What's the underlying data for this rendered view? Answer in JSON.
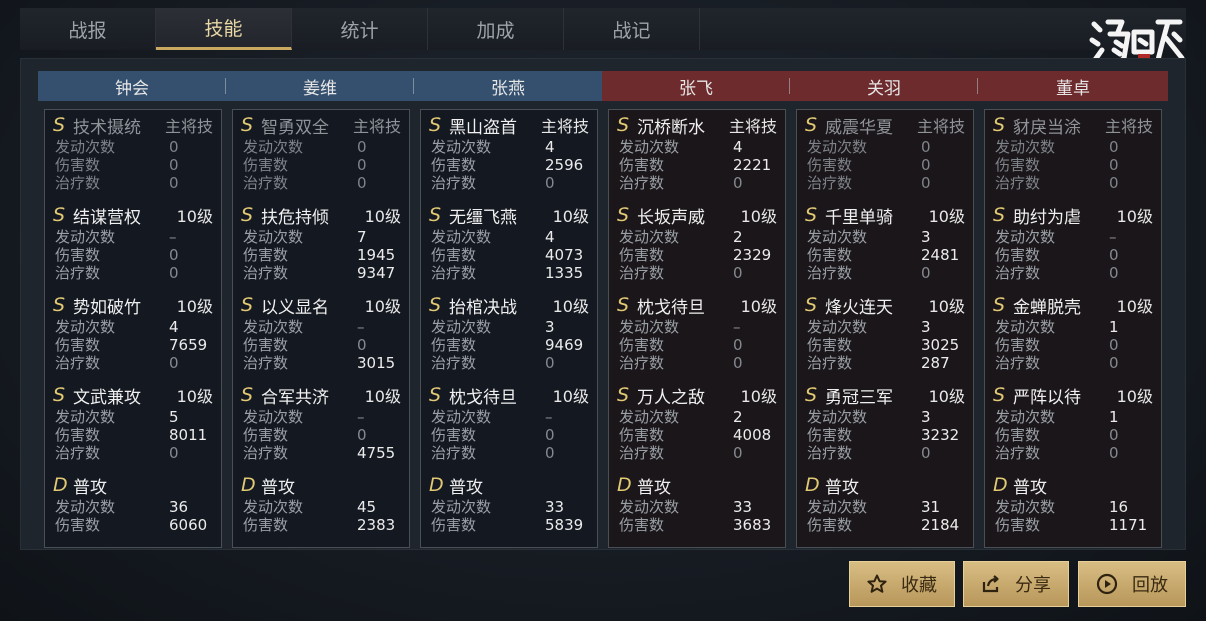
{
  "tabs": [
    "战报",
    "技能",
    "统计",
    "加成",
    "战记"
  ],
  "logo_text": "鸿图之下",
  "heroes": [
    {
      "name": "钟会",
      "side": "blue"
    },
    {
      "name": "姜维",
      "side": "blue"
    },
    {
      "name": "张燕",
      "side": "blue"
    },
    {
      "name": "张飞",
      "side": "red"
    },
    {
      "name": "关羽",
      "side": "red"
    },
    {
      "name": "董卓",
      "side": "red"
    }
  ],
  "stat_labels": {
    "trigger": "发动次数",
    "damage": "伤害数",
    "heal": "治疗数"
  },
  "columns": [
    {
      "skills": [
        {
          "grade": "S",
          "name": "技术摄统",
          "tag": "主将技",
          "dim": true,
          "trigger": "0",
          "damage": "0",
          "heal": "0"
        },
        {
          "grade": "S",
          "name": "结谋营权",
          "tag": "10级",
          "trigger": "–",
          "damage": "0",
          "heal": "0"
        },
        {
          "grade": "S",
          "name": "势如破竹",
          "tag": "10级",
          "trigger": "4",
          "damage": "7659",
          "heal": "0"
        },
        {
          "grade": "S",
          "name": "文武兼攻",
          "tag": "10级",
          "trigger": "5",
          "damage": "8011",
          "heal": "0"
        },
        {
          "grade": "D",
          "name": "普攻",
          "tag": "",
          "trigger": "36",
          "damage": "6060"
        }
      ]
    },
    {
      "skills": [
        {
          "grade": "S",
          "name": "智勇双全",
          "tag": "主将技",
          "dim": true,
          "trigger": "0",
          "damage": "0",
          "heal": "0"
        },
        {
          "grade": "S",
          "name": "扶危持倾",
          "tag": "10级",
          "trigger": "7",
          "damage": "1945",
          "heal": "9347"
        },
        {
          "grade": "S",
          "name": "以义显名",
          "tag": "10级",
          "trigger": "–",
          "damage": "0",
          "heal": "3015"
        },
        {
          "grade": "S",
          "name": "合军共济",
          "tag": "10级",
          "trigger": "–",
          "damage": "0",
          "heal": "4755"
        },
        {
          "grade": "D",
          "name": "普攻",
          "tag": "",
          "trigger": "45",
          "damage": "2383"
        }
      ]
    },
    {
      "skills": [
        {
          "grade": "S",
          "name": "黑山盗首",
          "tag": "主将技",
          "trigger": "4",
          "damage": "2596",
          "heal": "0"
        },
        {
          "grade": "S",
          "name": "无缰飞燕",
          "tag": "10级",
          "trigger": "4",
          "damage": "4073",
          "heal": "1335"
        },
        {
          "grade": "S",
          "name": "抬棺决战",
          "tag": "10级",
          "trigger": "3",
          "damage": "9469",
          "heal": "0"
        },
        {
          "grade": "S",
          "name": "枕戈待旦",
          "tag": "10级",
          "trigger": "–",
          "damage": "0",
          "heal": "0"
        },
        {
          "grade": "D",
          "name": "普攻",
          "tag": "",
          "trigger": "33",
          "damage": "5839"
        }
      ]
    },
    {
      "skills": [
        {
          "grade": "S",
          "name": "沉桥断水",
          "tag": "主将技",
          "trigger": "4",
          "damage": "2221",
          "heal": "0"
        },
        {
          "grade": "S",
          "name": "长坂声威",
          "tag": "10级",
          "trigger": "2",
          "damage": "2329",
          "heal": "0"
        },
        {
          "grade": "S",
          "name": "枕戈待旦",
          "tag": "10级",
          "trigger": "–",
          "damage": "0",
          "heal": "0"
        },
        {
          "grade": "S",
          "name": "万人之敌",
          "tag": "10级",
          "trigger": "2",
          "damage": "4008",
          "heal": "0"
        },
        {
          "grade": "D",
          "name": "普攻",
          "tag": "",
          "trigger": "33",
          "damage": "3683"
        }
      ]
    },
    {
      "skills": [
        {
          "grade": "S",
          "name": "威震华夏",
          "tag": "主将技",
          "dim": true,
          "trigger": "0",
          "damage": "0",
          "heal": "0"
        },
        {
          "grade": "S",
          "name": "千里单骑",
          "tag": "10级",
          "trigger": "3",
          "damage": "2481",
          "heal": "0"
        },
        {
          "grade": "S",
          "name": "烽火连天",
          "tag": "10级",
          "trigger": "3",
          "damage": "3025",
          "heal": "287"
        },
        {
          "grade": "S",
          "name": "勇冠三军",
          "tag": "10级",
          "trigger": "3",
          "damage": "3232",
          "heal": "0"
        },
        {
          "grade": "D",
          "name": "普攻",
          "tag": "",
          "trigger": "31",
          "damage": "2184"
        }
      ]
    },
    {
      "skills": [
        {
          "grade": "S",
          "name": "豺戾当涂",
          "tag": "主将技",
          "dim": true,
          "trigger": "0",
          "damage": "0",
          "heal": "0"
        },
        {
          "grade": "S",
          "name": "助纣为虐",
          "tag": "10级",
          "trigger": "–",
          "damage": "0",
          "heal": "0"
        },
        {
          "grade": "S",
          "name": "金蝉脱壳",
          "tag": "10级",
          "trigger": "1",
          "damage": "0",
          "heal": "0"
        },
        {
          "grade": "S",
          "name": "严阵以待",
          "tag": "10级",
          "trigger": "1",
          "damage": "0",
          "heal": "0"
        },
        {
          "grade": "D",
          "name": "普攻",
          "tag": "",
          "trigger": "16",
          "damage": "1171"
        }
      ]
    }
  ],
  "buttons": {
    "favorite": "收藏",
    "share": "分享",
    "replay": "回放"
  },
  "colors": {
    "gold": "#c9a860",
    "blue_team": "#34506e",
    "red_team": "#6e2b2e"
  }
}
